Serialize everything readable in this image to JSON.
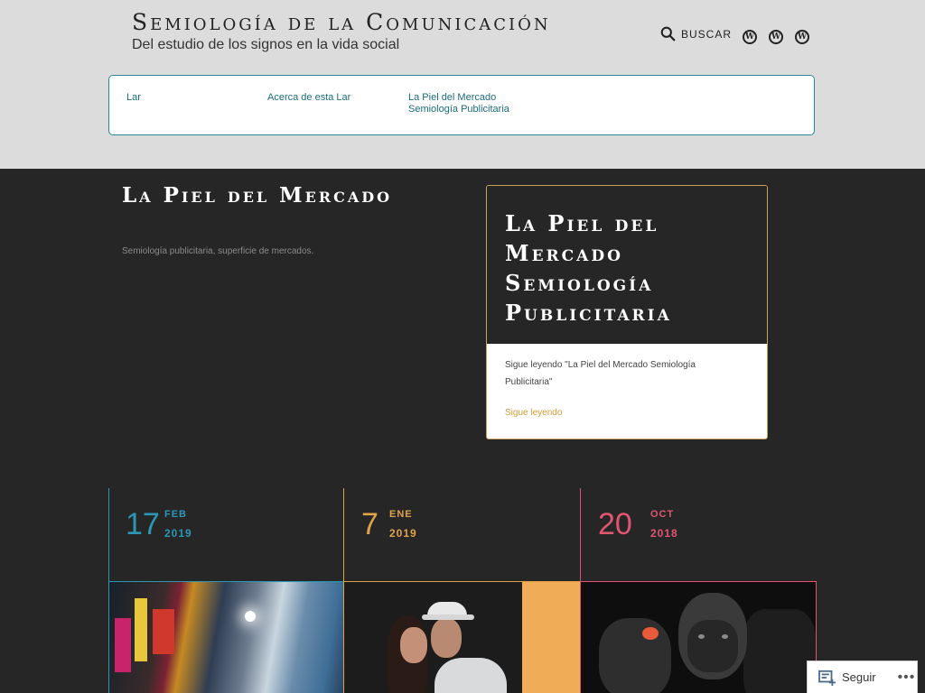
{
  "site": {
    "title": "Semiología de la Comunicación",
    "description": "Del estudio de los signos en la vida social",
    "search_label": "BUSCAR"
  },
  "social_icons": [
    "wordpress-icon",
    "wordpress-icon",
    "wordpress-icon"
  ],
  "nav": {
    "items": [
      {
        "label": "Lar"
      },
      {
        "label": "Acerca de esta Lar"
      },
      {
        "label": "La Piel del Mercado Semiología Publicitaria"
      }
    ]
  },
  "hero": {
    "title": "La Piel del Mercado",
    "description": "Semiología publicitaria, superficie de mercados."
  },
  "featured": {
    "title": "La Piel del Mercado Semiología Publicitaria",
    "excerpt": "Sigue leyendo \"La Piel del Mercado Semiología Publicitaria\"",
    "more": "Sigue leyendo"
  },
  "posts": [
    {
      "day": "17",
      "month": "FEB",
      "year": "2019",
      "color": "#2b97b5"
    },
    {
      "day": "7",
      "month": "ENE",
      "year": "2019",
      "color": "#e0a347"
    },
    {
      "day": "20",
      "month": "OCT",
      "year": "2018",
      "color": "#e05670"
    }
  ],
  "follow": {
    "label": "Seguir",
    "more": "•••"
  },
  "colors": {
    "header_bg": "#dcdcdc",
    "page_bg": "#262626",
    "nav_accent": "#1a6c7a",
    "link_accent": "#d69a35"
  }
}
